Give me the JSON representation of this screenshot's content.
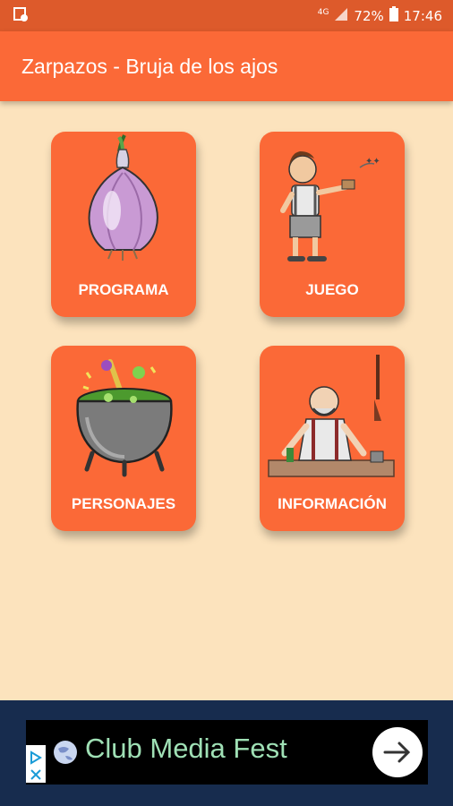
{
  "status_bar": {
    "network": "4G",
    "battery": "72%",
    "time": "17:46"
  },
  "app_bar": {
    "title": "Zarpazos - Bruja de los ajos"
  },
  "menu": {
    "items": [
      {
        "label": "PROGRAMA",
        "icon": "garlic-icon"
      },
      {
        "label": "JUEGO",
        "icon": "boy-character-icon"
      },
      {
        "label": "PERSONAJES",
        "icon": "cauldron-icon"
      },
      {
        "label": "INFORMACIÓN",
        "icon": "man-at-table-icon"
      }
    ]
  },
  "ad": {
    "text": "Club Media Fest",
    "icons": [
      "ad-choices-icon",
      "globe-icon",
      "arrow-right-icon"
    ]
  },
  "colors": {
    "status_bar": "#dd5a2b",
    "app_bar": "#fb6937",
    "background": "#fce3bd",
    "card": "#fb6937",
    "ad_area": "#172c4e",
    "ad_text": "#9fe0b5"
  }
}
